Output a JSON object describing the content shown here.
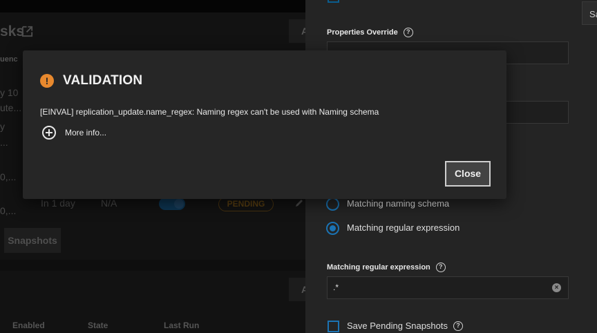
{
  "background": {
    "title_fragment": "sks",
    "column_fragment": "uenc",
    "add_fragment": "A",
    "rows": [
      {
        "line1": "y 10",
        "line2": "ute..."
      },
      {
        "line1": "y",
        "line2": "..."
      },
      {
        "line1": "0,..."
      },
      {
        "line1": "0,...",
        "frequency": "In 1 day",
        "next": "N/A",
        "state": "PENDING"
      }
    ],
    "snapshots_button": "Snapshots",
    "table_headers": [
      "Enabled",
      "State",
      "Last Run"
    ]
  },
  "panel": {
    "sa_button": "Sa",
    "properties_override": {
      "label": "Properties Override",
      "value": ""
    },
    "hidden_field_value": "",
    "radio_options": [
      {
        "label": "Matching naming schema",
        "selected": false
      },
      {
        "label": "Matching regular expression",
        "selected": true
      }
    ],
    "regex_field": {
      "label": "Matching regular expression",
      "value": ".*"
    },
    "save_pending": {
      "label": "Save Pending Snapshots",
      "checked": false
    }
  },
  "dialog": {
    "title": "VALIDATION",
    "message": "[EINVAL] replication_update.name_regex: Naming regex can't be used with Naming schema",
    "more_info": "More info...",
    "close_label": "Close",
    "icon": "warning-icon",
    "accent": "#e8892e"
  }
}
